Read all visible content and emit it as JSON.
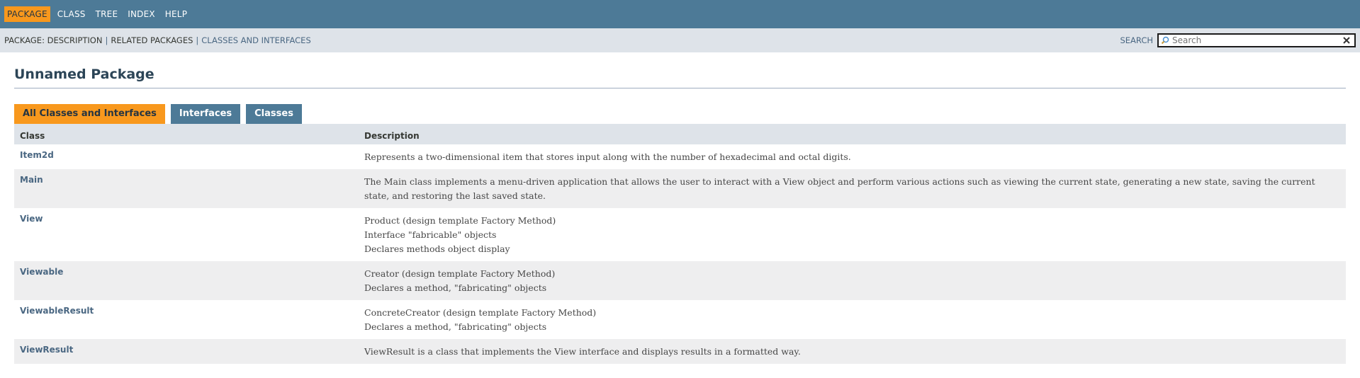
{
  "top_nav": {
    "items": [
      {
        "label": "PACKAGE",
        "active": true
      },
      {
        "label": "CLASS",
        "active": false
      },
      {
        "label": "TREE",
        "active": false
      },
      {
        "label": "INDEX",
        "active": false
      },
      {
        "label": "HELP",
        "active": false
      }
    ]
  },
  "sub_nav": {
    "prefix": "PACKAGE:",
    "links": [
      "DESCRIPTION",
      "RELATED PACKAGES",
      "CLASSES AND INTERFACES"
    ],
    "search_label": "SEARCH",
    "search_placeholder": "Search"
  },
  "page": {
    "title": "Unnamed Package"
  },
  "tabs": [
    {
      "label": "All Classes and Interfaces",
      "active": true
    },
    {
      "label": "Interfaces",
      "active": false
    },
    {
      "label": "Classes",
      "active": false
    }
  ],
  "table": {
    "headers": [
      "Class",
      "Description"
    ],
    "rows": [
      {
        "name": "Item2d",
        "desc": [
          "Represents a two-dimensional item that stores input along with the number of hexadecimal and octal digits."
        ]
      },
      {
        "name": "Main",
        "desc": [
          "The Main class implements a menu-driven application that allows the user to interact with a View object and perform various actions such as viewing the current state, generating a new state, saving the current state, and restoring the last saved state."
        ]
      },
      {
        "name": "View",
        "desc": [
          "Product (design template Factory Method)",
          "Interface \"fabricable\" objects",
          "Declares methods object display"
        ]
      },
      {
        "name": "Viewable",
        "desc": [
          "Creator (design template Factory Method)",
          "Declares a method, \"fabricating\" objects"
        ]
      },
      {
        "name": "ViewableResult",
        "desc": [
          "ConcreteCreator (design template Factory Method)",
          "Declares a method, \"fabricating\" objects"
        ]
      },
      {
        "name": "ViewResult",
        "desc": [
          "ViewResult is a class that implements the View interface and displays results in a formatted way."
        ]
      }
    ]
  },
  "colors": {
    "nav_bg": "#4d7a97",
    "active_accent": "#f8981d",
    "subnav_bg": "#dee3e9",
    "link": "#4a6782"
  }
}
